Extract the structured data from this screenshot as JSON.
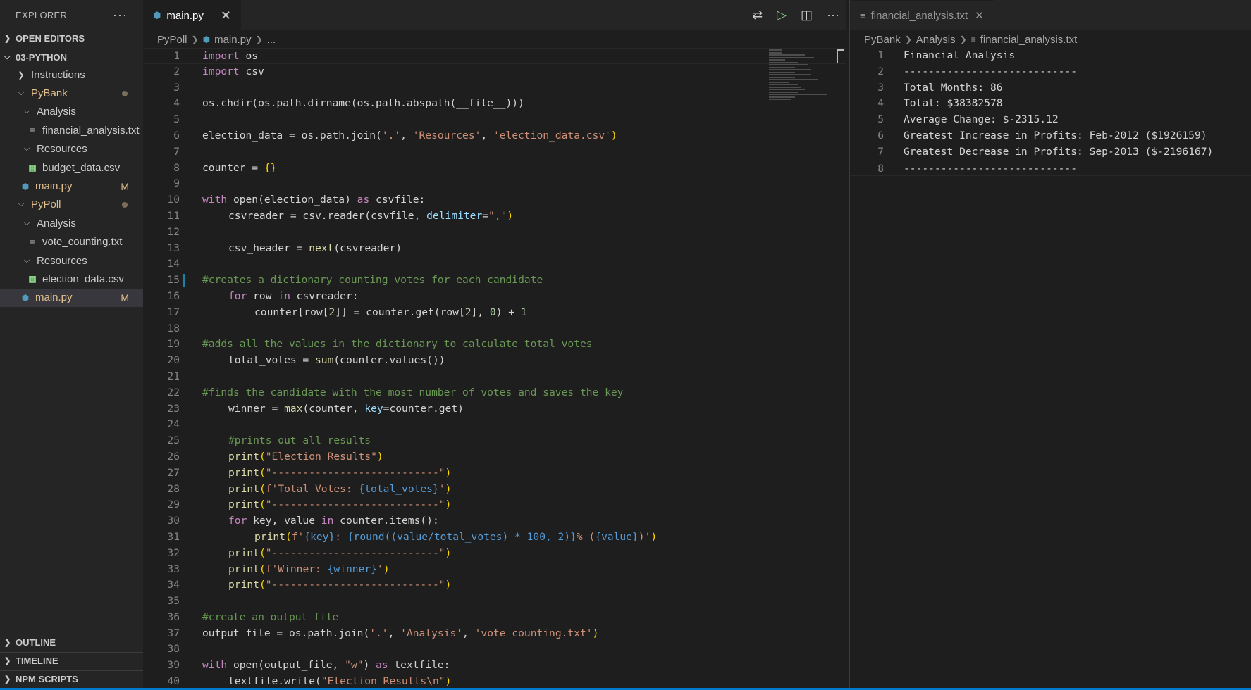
{
  "sidebar": {
    "title": "EXPLORER",
    "more": "···",
    "sections": {
      "open_editors": "OPEN EDITORS",
      "workspace": "03-PYTHON",
      "outline": "OUTLINE",
      "timeline": "TIMELINE",
      "npm": "NPM SCRIPTS"
    },
    "tree": {
      "instructions": "Instructions",
      "pybank": "PyBank",
      "pybank_analysis": "Analysis",
      "pybank_analysis_file": "financial_analysis.txt",
      "pybank_resources": "Resources",
      "pybank_resources_file": "budget_data.csv",
      "pybank_main": "main.py",
      "pybank_main_badge": "M",
      "pypoll": "PyPoll",
      "pypoll_analysis": "Analysis",
      "pypoll_analysis_file": "vote_counting.txt",
      "pypoll_resources": "Resources",
      "pypoll_resources_file": "election_data.csv",
      "pypoll_main": "main.py",
      "pypoll_main_badge": "M"
    }
  },
  "editor1": {
    "tab": "main.py",
    "close": "✕",
    "breadcrumb": [
      "PyPoll",
      "main.py",
      "..."
    ],
    "line_numbers": [
      "1",
      "2",
      "3",
      "4",
      "5",
      "6",
      "7",
      "8",
      "9",
      "10",
      "11",
      "12",
      "13",
      "14",
      "15",
      "16",
      "17",
      "18",
      "19",
      "20",
      "21",
      "22",
      "23",
      "24",
      "25",
      "26",
      "27",
      "28",
      "29",
      "30",
      "31",
      "32",
      "33",
      "34",
      "35",
      "36",
      "37",
      "38",
      "39",
      "40"
    ]
  },
  "editor2": {
    "tab": "financial_analysis.txt",
    "close": "✕",
    "breadcrumb": [
      "PyBank",
      "Analysis",
      "financial_analysis.txt"
    ],
    "lines": [
      {
        "n": "1",
        "text": "Financial Analysis"
      },
      {
        "n": "2",
        "text": "----------------------------"
      },
      {
        "n": "3",
        "text": "Total Months: 86"
      },
      {
        "n": "4",
        "text": "Total: $38382578"
      },
      {
        "n": "5",
        "text": "Average Change: $-2315.12"
      },
      {
        "n": "6",
        "text": "Greatest Increase in Profits: Feb-2012 ($1926159)"
      },
      {
        "n": "7",
        "text": "Greatest Decrease in Profits: Sep-2013 ($-2196167)"
      },
      {
        "n": "8",
        "text": "----------------------------"
      }
    ]
  },
  "code": {
    "l1a": "import",
    "l1b": " os",
    "l2a": "import",
    "l2b": " csv",
    "l4": "os.chdir(os.path.dirname(os.path.abspath(__file__)))",
    "l6a": "election_data = os.path.join(",
    "l6b": "'.'",
    "l6c": ", ",
    "l6d": "'Resources'",
    "l6e": ", ",
    "l6f": "'election_data.csv'",
    "l6g": ")",
    "l8a": "counter = ",
    "l8b": "{}",
    "l10a": "with",
    "l10b": " open(election_data) ",
    "l10c": "as",
    "l10d": " csvfile:",
    "l11a": "csvreader = csv.reader(csvfile, ",
    "l11b": "delimiter",
    "l11c": "=",
    "l11d": "\",\"",
    "l11e": ")",
    "l13a": "csv_header = ",
    "l13b": "next",
    "l13c": "(csvreader)",
    "l15": "#creates a dictionary counting votes for each candidate",
    "l16a": "for",
    "l16b": " row ",
    "l16c": "in",
    "l16d": " csvreader:",
    "l17a": "counter[row[",
    "l17b": "2",
    "l17c": "]] = counter.get(row[",
    "l17d": "2",
    "l17e": "], ",
    "l17f": "0",
    "l17g": ") + ",
    "l17h": "1",
    "l19": "#adds all the values in the dictionary to calculate total votes",
    "l20a": "total_votes = ",
    "l20b": "sum",
    "l20c": "(counter.values())",
    "l22": "#finds the candidate with the most number of votes and saves the key",
    "l23a": "winner = ",
    "l23b": "max",
    "l23c": "(counter, ",
    "l23d": "key",
    "l23e": "=counter.get)",
    "l25": "#prints out all results",
    "l26a": "print",
    "l26b": "(",
    "l26c": "\"Election Results\"",
    "l26d": ")",
    "l27a": "print",
    "l27b": "(",
    "l27c": "\"---------------------------\"",
    "l27d": ")",
    "l28a": "print",
    "l28b": "(",
    "l28c": "f'Total Votes: ",
    "l28d": "{total_votes}",
    "l28e": "'",
    "l28f": ")",
    "l29a": "print",
    "l29b": "(",
    "l29c": "\"---------------------------\"",
    "l29d": ")",
    "l30a": "for",
    "l30b": " key, value ",
    "l30c": "in",
    "l30d": " counter.items():",
    "l31a": "print",
    "l31b": "(",
    "l31c": "f'",
    "l31d": "{key}",
    "l31e": ": ",
    "l31f": "{round((value/total_votes) * 100, 2)}",
    "l31g": "% (",
    "l31h": "{value}",
    "l31i": ")'",
    "l31j": ")",
    "l32a": "print",
    "l32b": "(",
    "l32c": "\"---------------------------\"",
    "l32d": ")",
    "l33a": "print",
    "l33b": "(",
    "l33c": "f'Winner: ",
    "l33d": "{winner}",
    "l33e": "'",
    "l33f": ")",
    "l34a": "print",
    "l34b": "(",
    "l34c": "\"---------------------------\"",
    "l34d": ")",
    "l36": "#create an output file",
    "l37a": "output_file = os.path.join(",
    "l37b": "'.'",
    "l37c": ", ",
    "l37d": "'Analysis'",
    "l37e": ", ",
    "l37f": "'vote_counting.txt'",
    "l37g": ")",
    "l39a": "with",
    "l39b": " open(output_file, ",
    "l39c": "\"w\"",
    "l39d": ") ",
    "l39e": "as",
    "l39f": " textfile:",
    "l40a": "textfile.write(",
    "l40b": "\"Election Results\\n\"",
    "l40c": ")"
  }
}
